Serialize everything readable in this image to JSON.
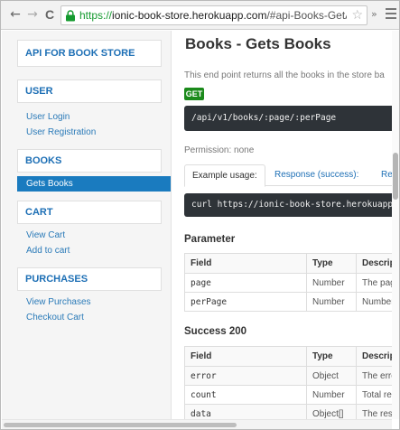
{
  "browser": {
    "back_icon": "←",
    "forward_icon": "→",
    "reload_icon": "C",
    "url_scheme": "https://",
    "url_host": "ionic-book-store.herokuapp.com",
    "url_path": "/#api-Books-GetAllBooks",
    "star_icon": "☆",
    "overflow_icon": "»"
  },
  "sidebar": {
    "title": "API FOR BOOK STORE",
    "groups": [
      {
        "label": "USER",
        "items": [
          "User Login",
          "User Registration"
        ]
      },
      {
        "label": "BOOKS",
        "items": [
          "Gets Books"
        ]
      },
      {
        "label": "CART",
        "items": [
          "View Cart",
          "Add to cart"
        ]
      },
      {
        "label": "PURCHASES",
        "items": [
          "View Purchases",
          "Checkout Cart"
        ]
      }
    ],
    "active_item": "Gets Books",
    "accent_color": "#1a7bbf"
  },
  "main": {
    "title": "Books - Gets Books",
    "description": "This end point returns all the books in the store ba",
    "method": "GET",
    "endpoint": "/api/v1/books/:page/:perPage",
    "permission": "Permission: none",
    "tabs": [
      "Example usage:",
      "Response (success):",
      "Resp"
    ],
    "active_tab": "Example usage:",
    "curl": "curl https://ionic-book-store.herokuapp",
    "parameter": {
      "title": "Parameter",
      "headers": [
        "Field",
        "Type",
        "Descript"
      ],
      "rows": [
        [
          "page",
          "Number",
          "The page"
        ],
        [
          "perPage",
          "Number",
          "Number"
        ]
      ]
    },
    "success": {
      "title": "Success 200",
      "headers": [
        "Field",
        "Type",
        "Descript"
      ],
      "rows": [
        [
          "error",
          "Object",
          "The erro"
        ],
        [
          "count",
          "Number",
          "Total rec"
        ],
        [
          "data",
          "Object[]",
          "The resp"
        ]
      ]
    }
  }
}
